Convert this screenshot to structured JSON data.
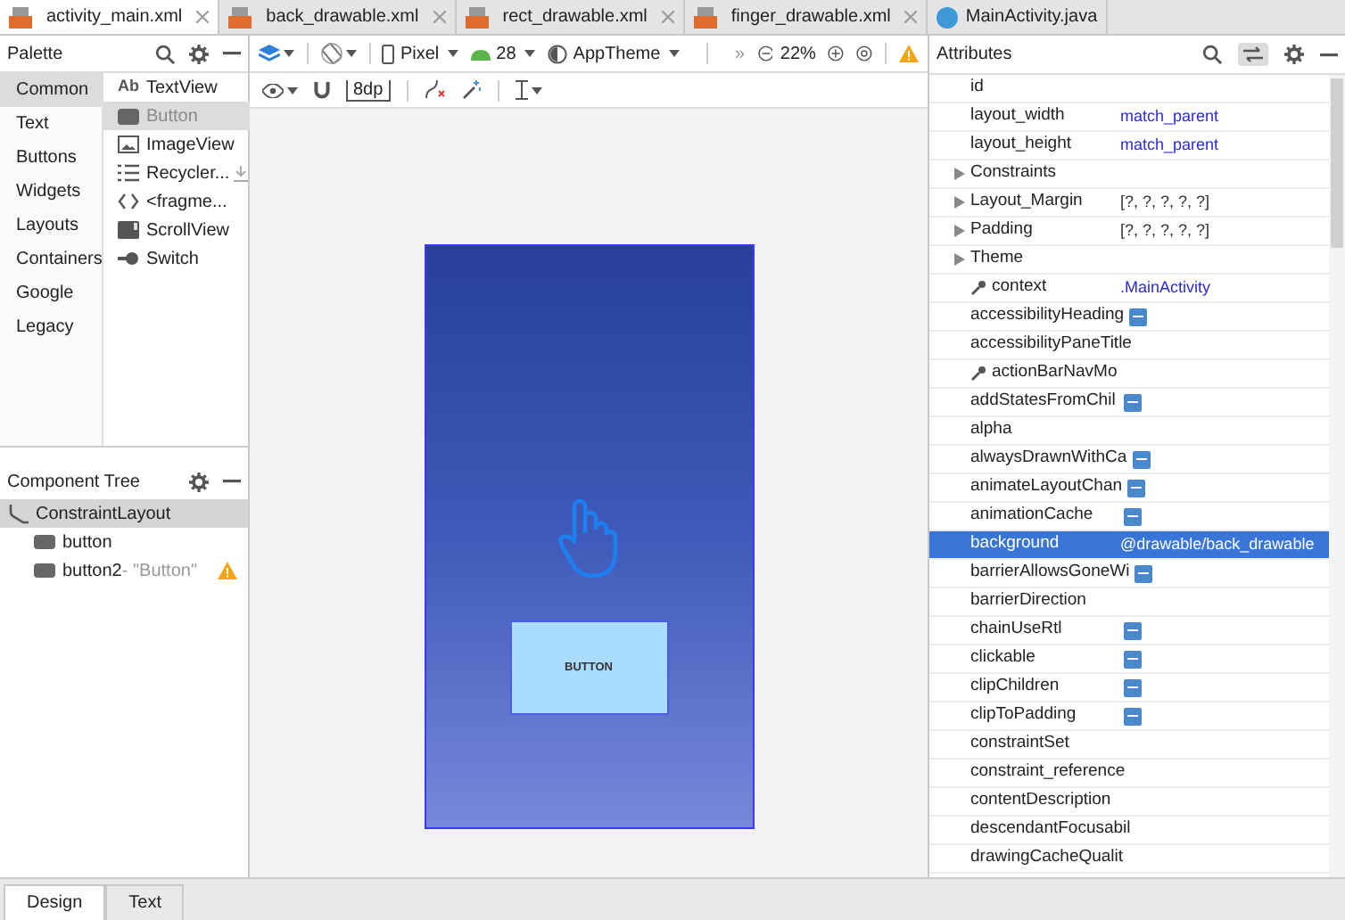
{
  "tabs": [
    {
      "label": "activity_main.xml",
      "kind": "xml",
      "selected": true
    },
    {
      "label": "back_drawable.xml",
      "kind": "xml",
      "selected": false
    },
    {
      "label": "rect_drawable.xml",
      "kind": "xml",
      "selected": false
    },
    {
      "label": "finger_drawable.xml",
      "kind": "xml",
      "selected": false
    },
    {
      "label": "MainActivity.java",
      "kind": "java",
      "selected": false
    }
  ],
  "palette": {
    "title": "Palette",
    "categories": [
      {
        "label": "Common",
        "selected": true
      },
      {
        "label": "Text",
        "selected": false
      },
      {
        "label": "Buttons",
        "selected": false
      },
      {
        "label": "Widgets",
        "selected": false
      },
      {
        "label": "Layouts",
        "selected": false
      },
      {
        "label": "Containers",
        "selected": false
      },
      {
        "label": "Google",
        "selected": false
      },
      {
        "label": "Legacy",
        "selected": false
      }
    ],
    "widgets": [
      {
        "label": "TextView",
        "kind": "text",
        "icon_text": "Ab",
        "selected": false
      },
      {
        "label": "Button",
        "kind": "button",
        "selected": true
      },
      {
        "label": "ImageView",
        "kind": "image",
        "selected": false
      },
      {
        "label": "Recycler...",
        "kind": "list",
        "selected": false,
        "download": true
      },
      {
        "label": "<fragme...",
        "kind": "fragment",
        "selected": false
      },
      {
        "label": "ScrollView",
        "kind": "scroll",
        "selected": false
      },
      {
        "label": "Switch",
        "kind": "switch",
        "selected": false
      }
    ]
  },
  "component_tree": {
    "title": "Component Tree",
    "items": [
      {
        "label": "ConstraintLayout",
        "selected": true,
        "children": [
          {
            "label": "button",
            "selected": false
          },
          {
            "label": "button2",
            "hint": "- \"Button\"",
            "warning": true,
            "selected": false
          }
        ]
      }
    ]
  },
  "toolbar": {
    "device": "Pixel",
    "api": "28",
    "theme": "AppTheme",
    "overflow": "»",
    "zoom": "22%",
    "margin": "8dp"
  },
  "preview": {
    "button_label": "BUTTON"
  },
  "attributes": {
    "title": "Attributes",
    "rows": [
      {
        "name": "id",
        "kind": "plain",
        "selected": false
      },
      {
        "name": "layout_width",
        "value": "match_parent",
        "kind": "plain",
        "selected": false
      },
      {
        "name": "layout_height",
        "value": "match_parent",
        "kind": "plain",
        "selected": false
      },
      {
        "name": "Constraints",
        "kind": "group",
        "expanded": false,
        "selected": false
      },
      {
        "name": "Layout_Margin",
        "value": "[?, ?, ?, ?, ?]",
        "kind": "group",
        "expanded": false,
        "selected": false
      },
      {
        "name": "Padding",
        "value": "[?, ?, ?, ?, ?]",
        "kind": "group",
        "expanded": false,
        "selected": false
      },
      {
        "name": "Theme",
        "kind": "group",
        "expanded": false,
        "selected": false
      },
      {
        "name": "context",
        "value": ".MainActivity",
        "kind": "tool",
        "selected": false
      },
      {
        "name": "accessibilityHeading",
        "kind": "toggle",
        "selected": false
      },
      {
        "name": "accessibilityPaneTitle",
        "kind": "plain",
        "selected": false
      },
      {
        "name": "actionBarNavMo",
        "kind": "tool",
        "selected": false
      },
      {
        "name": "addStatesFromChil",
        "kind": "toggle",
        "selected": false
      },
      {
        "name": "alpha",
        "kind": "plain",
        "selected": false
      },
      {
        "name": "alwaysDrawnWithCa",
        "kind": "toggle",
        "selected": false
      },
      {
        "name": "animateLayoutChan",
        "kind": "toggle",
        "selected": false
      },
      {
        "name": "animationCache",
        "kind": "toggle",
        "selected": false
      },
      {
        "name": "background",
        "value": "@drawable/back_drawable",
        "kind": "plain",
        "selected": true
      },
      {
        "name": "barrierAllowsGoneWi",
        "kind": "toggle",
        "selected": false
      },
      {
        "name": "barrierDirection",
        "kind": "plain",
        "selected": false
      },
      {
        "name": "chainUseRtl",
        "kind": "toggle",
        "selected": false
      },
      {
        "name": "clickable",
        "kind": "toggle",
        "selected": false
      },
      {
        "name": "clipChildren",
        "kind": "toggle",
        "selected": false
      },
      {
        "name": "clipToPadding",
        "kind": "toggle",
        "selected": false
      },
      {
        "name": "constraintSet",
        "kind": "plain",
        "selected": false
      },
      {
        "name": "constraint_reference",
        "kind": "plain",
        "selected": false
      },
      {
        "name": "contentDescription",
        "kind": "plain",
        "selected": false
      },
      {
        "name": "descendantFocusabil",
        "kind": "plain",
        "selected": false
      },
      {
        "name": "drawingCacheQualit",
        "kind": "plain",
        "selected": false
      }
    ]
  },
  "bottom_tabs": [
    {
      "label": "Design",
      "selected": true
    },
    {
      "label": "Text",
      "selected": false
    }
  ]
}
